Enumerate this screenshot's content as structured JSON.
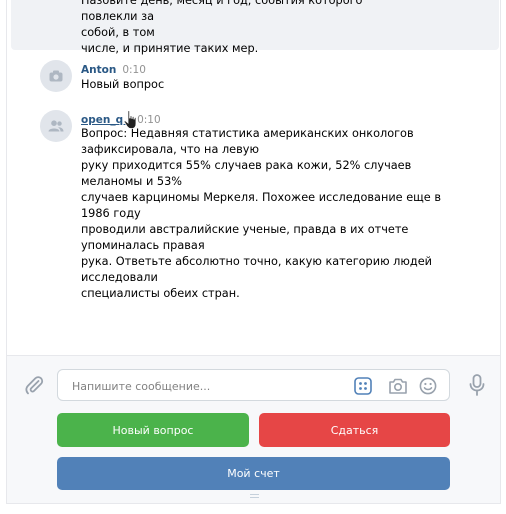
{
  "top_message": {
    "lines": [
      "Назовите день, месяц и год, события которого повлекли за",
      "собой, в том",
      "числе, и принятие таких мер."
    ]
  },
  "messages": [
    {
      "author": "Anton",
      "time": "0:10",
      "avatar_icon": "camera-icon",
      "lines": [
        "Новый вопрос"
      ]
    },
    {
      "author": "open_q..",
      "time": "0:10",
      "avatar_icon": "group-icon",
      "lines": [
        "Вопрос: Недавняя статистика американских онкологов",
        "зафиксировала, что на левую",
        "руку приходится 55% случаев рака кожи, 52% случаев",
        "меланомы и 53%",
        "случаев карциномы Меркеля. Похожее исследование еще в",
        "1986 году",
        "проводили австралийские ученые, правда в их отчете",
        "упоминалась правая",
        "рука. Ответьте абсолютно точно, какую категорию людей",
        "исследовали",
        "специалисты обеих стран."
      ]
    }
  ],
  "composer": {
    "placeholder": "Напишите сообщение...",
    "buttons": {
      "new_question": "Новый вопрос",
      "give_up": "Сдаться",
      "my_score": "Мой счет"
    }
  },
  "colors": {
    "green": "#4bb34b",
    "red": "#e64646",
    "blue": "#5181b8",
    "link": "#2a5885"
  }
}
